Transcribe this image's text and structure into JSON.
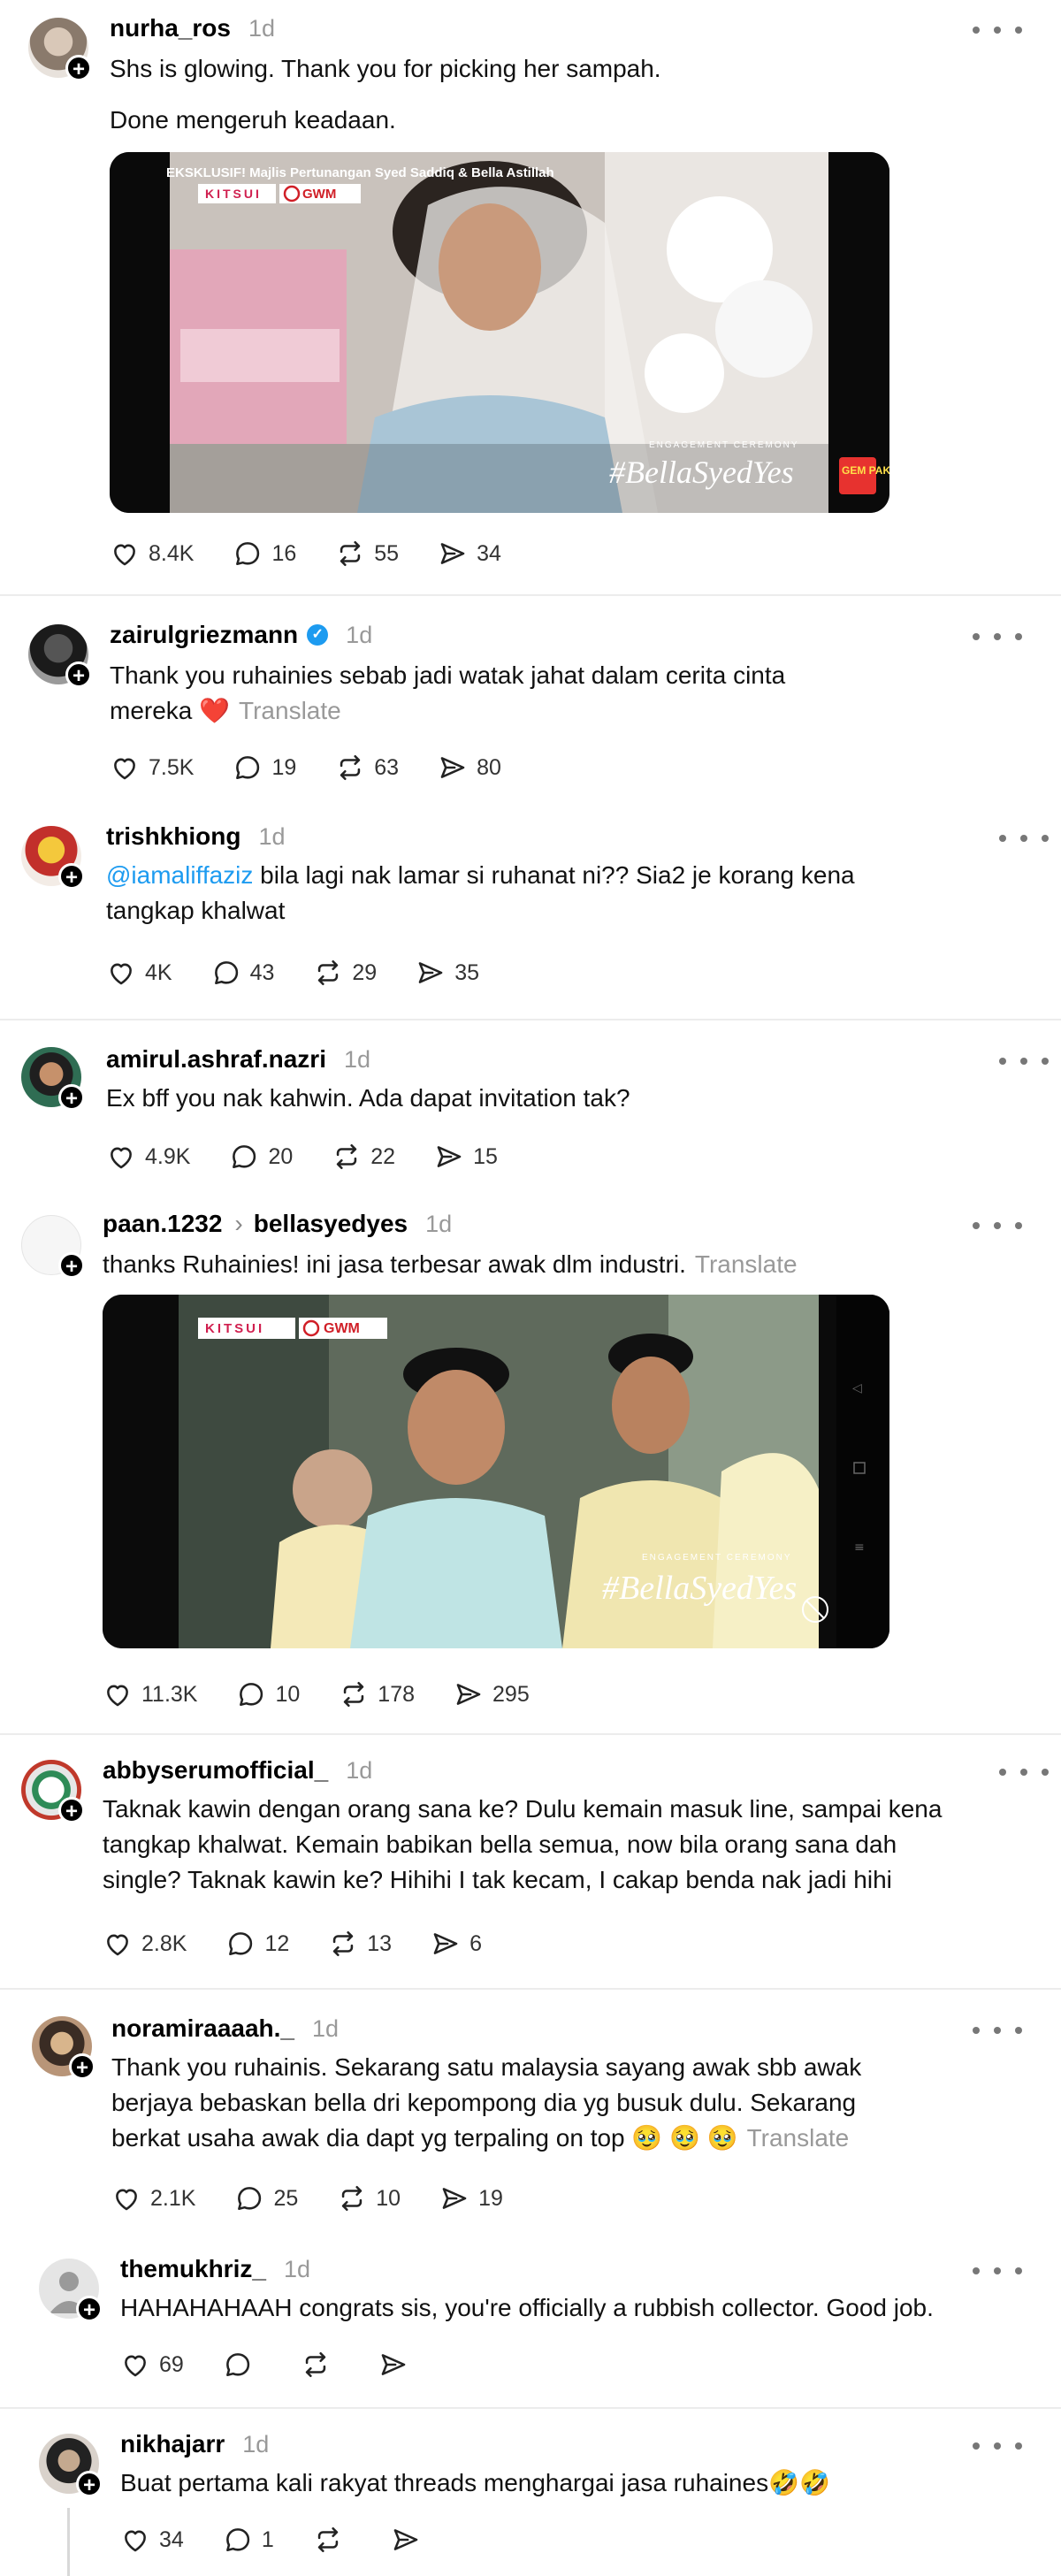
{
  "posts": [
    {
      "username": "nurha_ros",
      "time": "1d",
      "text1": "Shs is glowing. Thank you for picking her sampah.",
      "text2": "Done mengeruh keadaan.",
      "media": {
        "caption_top": "EKSKLUSIF! Majlis Pertunangan Syed Saddiq & Bella Astillah",
        "brand1": "KITSUI",
        "brand2": "GWM",
        "ceremony": "ENGAGEMENT CEREMONY",
        "hashtag": "#BellaSyedYes",
        "badge": "GEM PAK"
      },
      "likes": "8.4K",
      "replies": "16",
      "reposts": "55",
      "shares": "34"
    },
    {
      "username": "zairulgriezmann",
      "time": "1d",
      "text1": "Thank you ruhainies sebab jadi watak jahat dalam cerita cinta",
      "text2": "mereka",
      "translate": "Translate",
      "likes": "7.5K",
      "replies": "19",
      "reposts": "63",
      "shares": "80"
    },
    {
      "username": "trishkhiong",
      "time": "1d",
      "mention": "@iamaliffaziz",
      "text1": " bila lagi nak lamar si ruhanat ni?? Sia2 je korang kena",
      "text2": "tangkap khalwat",
      "likes": "4K",
      "replies": "43",
      "reposts": "29",
      "shares": "35"
    },
    {
      "username": "amirul.ashraf.nazri",
      "time": "1d",
      "text1": "Ex bff you nak kahwin. Ada dapat invitation tak?",
      "likes": "4.9K",
      "replies": "20",
      "reposts": "22",
      "shares": "15"
    },
    {
      "username": "paan.1232",
      "reply_to": "bellasyedyes",
      "time": "1d",
      "text1": "thanks Ruhainies! ini jasa terbesar awak dlm industri.",
      "translate": "Translate",
      "media": {
        "brand1": "KITSUI",
        "brand2": "GWM",
        "ceremony": "ENGAGEMENT CEREMONY",
        "hashtag": "#BellaSyedYes"
      },
      "likes": "11.3K",
      "replies": "10",
      "reposts": "178",
      "shares": "295"
    },
    {
      "username": "abbyserumofficial_",
      "time": "1d",
      "text1": "Taknak kawin dengan orang sana ke? Dulu kemain masuk line, sampai kena",
      "text2": "tangkap khalwat. Kemain babikan bella semua, now bila orang sana dah",
      "text3": "single? Taknak kawin ke? Hihihi I tak kecam, I cakap benda nak jadi hihi",
      "likes": "2.8K",
      "replies": "12",
      "reposts": "13",
      "shares": "6"
    },
    {
      "username": "noramiraaaah._",
      "time": "1d",
      "text1": "Thank you ruhainis. Sekarang satu malaysia sayang awak sbb awak",
      "text2": "berjaya bebaskan bella dri kepompong dia yg busuk dulu. Sekarang",
      "text3": "berkat usaha awak dia dapt yg terpaling on top",
      "emojis": "🥹 🥹 🥹",
      "translate": "Translate",
      "likes": "2.1K",
      "replies": "25",
      "reposts": "10",
      "shares": "19"
    },
    {
      "username": "themukhriz_",
      "time": "1d",
      "text1": "HAHAHAHAAH congrats sis, you're officially a rubbish collector. Good job.",
      "likes": "69"
    },
    {
      "username": "nikhajarr",
      "time": "1d",
      "text1": "Buat pertama kali rakyat threads menghargai jasa ruhaines",
      "emojis": "🤣🤣",
      "likes": "34",
      "replies": "1"
    }
  ],
  "colors": {
    "link": "#1d9bf0",
    "muted": "#999999",
    "heart": "#e0162b"
  }
}
